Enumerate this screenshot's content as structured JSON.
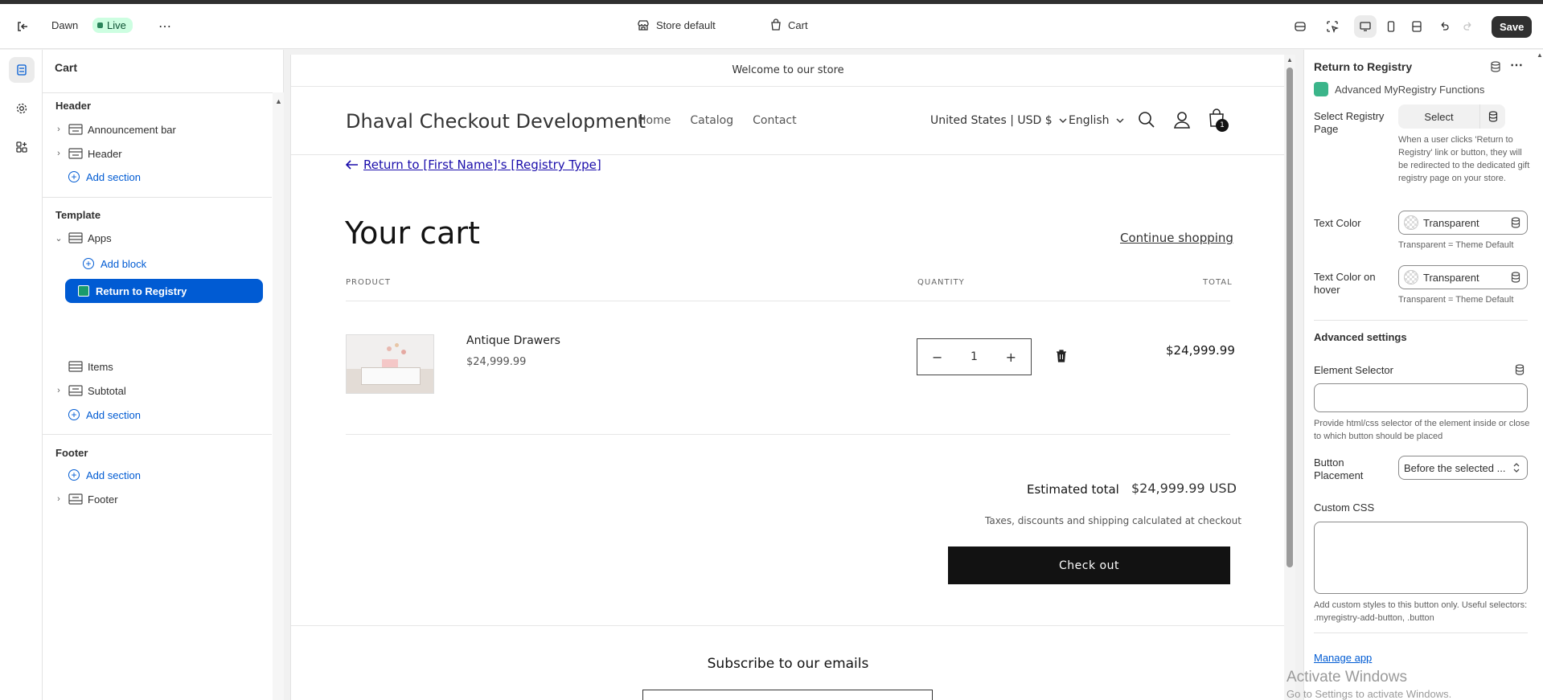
{
  "topbar": {
    "theme_name": "Dawn",
    "live_badge": "Live",
    "store_label": "Store default",
    "page_label": "Cart",
    "save_label": "Save"
  },
  "left_panel": {
    "title": "Cart",
    "header_group": "Header",
    "announcement_bar": "Announcement bar",
    "header_item": "Header",
    "add_section": "Add section",
    "template_group": "Template",
    "apps": "Apps",
    "add_block": "Add block",
    "return_to_registry": "Return to Registry",
    "items": "Items",
    "subtotal": "Subtotal",
    "footer_group": "Footer",
    "footer_item": "Footer"
  },
  "preview": {
    "announcement": "Welcome to our store",
    "store_name": "Dhaval Checkout Development",
    "nav": [
      "Home",
      "Catalog",
      "Contact"
    ],
    "country": "United States | USD $",
    "language": "English",
    "cart_count": "1",
    "registry_link": "Return to [First Name]'s [Registry Type]",
    "heading": "Your cart",
    "continue_shopping": "Continue shopping",
    "col_product": "PRODUCT",
    "col_quantity": "QUANTITY",
    "col_total": "TOTAL",
    "item_name": "Antique Drawers",
    "item_price": "$24,999.99",
    "item_qty": "1",
    "item_total": "$24,999.99",
    "estimated_label": "Estimated total",
    "estimated_value": "$24,999.99 USD",
    "tax_note": "Taxes, discounts and shipping calculated at checkout",
    "checkout": "Check out",
    "subscribe": "Subscribe to our emails"
  },
  "right_panel": {
    "title": "Return to Registry",
    "app_name": "Advanced MyRegistry Functions",
    "select_page_label": "Select Registry Page",
    "select_button": "Select",
    "select_help": "When a user clicks 'Return to Registry' link or button, they will be redirected to the dedicated gift registry page on your store.",
    "text_color_label": "Text Color",
    "text_color_value": "Transparent",
    "text_color_help": "Transparent = Theme Default",
    "hover_color_label": "Text Color on hover",
    "hover_color_value": "Transparent",
    "hover_color_help": "Transparent = Theme Default",
    "advanced_heading": "Advanced settings",
    "element_selector_label": "Element Selector",
    "element_selector_value": "",
    "element_selector_help": "Provide html/css selector of the element inside or close to which button should be placed",
    "button_placement_label": "Button Placement",
    "button_placement_value": "Before the selected ...",
    "custom_css_label": "Custom CSS",
    "custom_css_value": "",
    "custom_css_help": "Add custom styles to this button only. Useful selectors: .myregistry-add-button, .button",
    "manage_app": "Manage app"
  },
  "watermark": {
    "line1": "Activate Windows",
    "line2": "Go to Settings to activate Windows."
  }
}
